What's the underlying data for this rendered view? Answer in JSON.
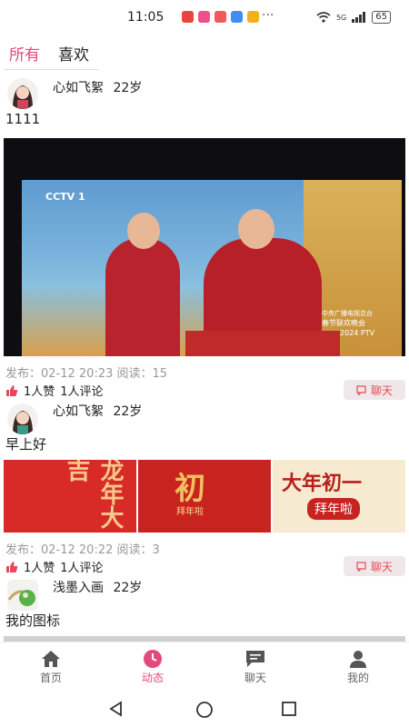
{
  "status": {
    "time": "11:05",
    "network": "5G",
    "battery": "65",
    "dots": "···"
  },
  "tabs": [
    {
      "label": "所有",
      "active": true
    },
    {
      "label": "喜欢",
      "active": false
    }
  ],
  "posts": [
    {
      "name": "心如飞絮",
      "age": "22岁",
      "text": "1111",
      "meta": "发布：02-12 20:23  阅读：15",
      "likes": "1人赞",
      "comments": "1人评论",
      "chat": "聊天",
      "image_text": {
        "channel": "CCTV 1",
        "banner": "中央广播电视总台",
        "banner2": "春节联欢晚会",
        "tag": "2024 PTV"
      }
    },
    {
      "name": "心如飞絮",
      "age": "22岁",
      "text": "早上好",
      "meta": "发布：02-12 20:22  阅读：3",
      "likes": "1人赞",
      "comments": "1人评论",
      "chat": "聊天",
      "image_text": {
        "img1": "龙年大吉",
        "img2": "初",
        "img2b": "拜年啦",
        "img3": "大年初一",
        "img3b": "拜年啦"
      }
    },
    {
      "name": "浅墨入画",
      "age": "22岁",
      "text": "我的图标"
    }
  ],
  "nav": [
    {
      "label": "首页",
      "icon": "home-icon",
      "active": false
    },
    {
      "label": "动态",
      "icon": "clock-icon",
      "active": true
    },
    {
      "label": "聊天",
      "icon": "chat-icon",
      "active": false
    },
    {
      "label": "我的",
      "icon": "user-icon",
      "active": false
    }
  ],
  "colors": {
    "accent": "#e4487d",
    "like": "#e64a5a"
  }
}
